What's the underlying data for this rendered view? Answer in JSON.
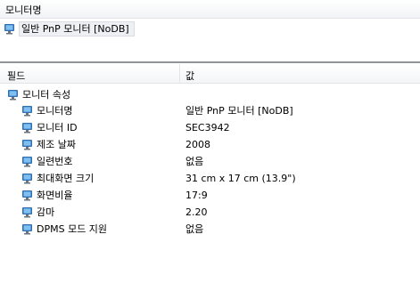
{
  "top": {
    "header_label": "모니터명",
    "monitor_name": "일반 PnP 모니터 [NoDB]"
  },
  "grid": {
    "col_field": "필드",
    "col_value": "값",
    "group_label": "모니터 속성",
    "rows": [
      {
        "field": "모니터명",
        "value": "일반 PnP 모니터 [NoDB]"
      },
      {
        "field": "모니터 ID",
        "value": "SEC3942"
      },
      {
        "field": "제조 날짜",
        "value": "2008"
      },
      {
        "field": "일련번호",
        "value": "없음"
      },
      {
        "field": "최대화면 크기",
        "value": "31 cm x 17 cm (13.9\")"
      },
      {
        "field": "화면비율",
        "value": "17:9"
      },
      {
        "field": "감마",
        "value": "2.20"
      },
      {
        "field": "DPMS 모드 지원",
        "value": "없음"
      }
    ]
  },
  "icons": {
    "monitor": "monitor-icon"
  },
  "colors": {
    "monitor_frame": "#2f6fb3",
    "monitor_screen": "#7fc0f0",
    "splitter": "#8d9398"
  }
}
